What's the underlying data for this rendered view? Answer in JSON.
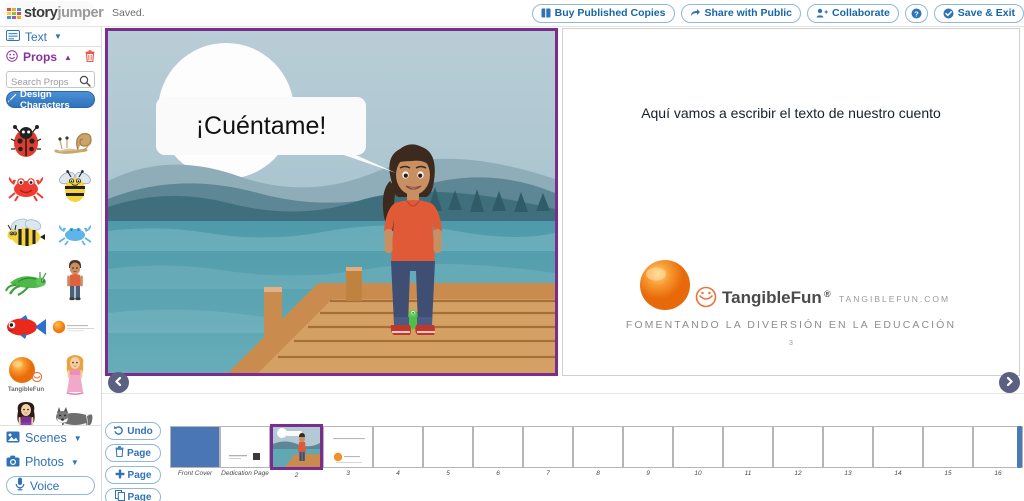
{
  "app": {
    "brand_story": "story",
    "brand_jumper": "jumper",
    "save_status": "Saved."
  },
  "header": {
    "buttons": [
      {
        "label": "Buy Published Copies",
        "icon": "book-icon"
      },
      {
        "label": "Share with Public",
        "icon": "share-arrow-icon"
      },
      {
        "label": "Collaborate",
        "icon": "add-user-icon"
      },
      {
        "label": "",
        "icon": "help-question-icon"
      },
      {
        "label": "Save & Exit",
        "icon": "check-circle-icon"
      }
    ]
  },
  "sidebar": {
    "text_panel": {
      "label": "Text",
      "icon": "text-box-icon",
      "caret": "▼"
    },
    "props_panel": {
      "label": "Props",
      "icon": "smiley-icon",
      "caret": "▲",
      "trash_icon": "trash-icon"
    },
    "search": {
      "placeholder": "Search Props",
      "value": "",
      "icon": "search-icon"
    },
    "design_button": {
      "label": "Design Characters",
      "icon": "brush-icon"
    },
    "props": [
      {
        "name": "ladybug"
      },
      {
        "name": "snail"
      },
      {
        "name": "red-crab"
      },
      {
        "name": "yellow-bee-character"
      },
      {
        "name": "bumblebee"
      },
      {
        "name": "blue-crab"
      },
      {
        "name": "grasshopper"
      },
      {
        "name": "boy-character"
      },
      {
        "name": "red-fish"
      },
      {
        "name": "tangiblefun-logo-wide"
      },
      {
        "name": "orange-ball-logo"
      },
      {
        "name": "princess-pink"
      },
      {
        "name": "princess-purple"
      },
      {
        "name": "husky-dog"
      }
    ],
    "scenes_panel": {
      "label": "Scenes",
      "icon": "image-icon",
      "caret": "▼"
    },
    "photos_panel": {
      "label": "Photos",
      "icon": "camera-icon",
      "caret": "▼"
    },
    "voice_button": {
      "label": "Voice",
      "icon": "microphone-icon"
    }
  },
  "canvas": {
    "left_page": {
      "speech_bubble_text": "¡Cuéntame!",
      "scene_name": "lake-dock-scene",
      "character_name": "girl-character",
      "prop_name": "frog-prop",
      "selected": true,
      "selection_color": "#7b2d8e"
    },
    "right_page": {
      "body_text": "Aquí vamos a escribir el texto de nuestro cuento",
      "brand_name": "TangibleFun",
      "brand_registered": "®",
      "brand_url": "TANGIBLEFUN.COM",
      "brand_tagline": "FOMENTANDO LA DIVERSIÓN EN LA EDUCACIÓN",
      "page_number": "3"
    },
    "nav_prev": {
      "icon": "chevron-left-icon"
    },
    "nav_next": {
      "icon": "chevron-right-icon"
    }
  },
  "filmstrip": {
    "tools": [
      {
        "label": "Undo",
        "icon": "undo-icon"
      },
      {
        "label": "Page",
        "icon": "trash-icon"
      },
      {
        "label": "Page",
        "icon": "plus-icon"
      },
      {
        "label": "Page",
        "icon": "copy-icon"
      }
    ],
    "thumbnails": [
      {
        "label": "Front Cover",
        "type": "cover",
        "selected": false
      },
      {
        "label": "Dedication Page",
        "type": "dedication",
        "selected": false
      },
      {
        "label": "2",
        "type": "scene",
        "selected": true
      },
      {
        "label": "3",
        "type": "brand",
        "selected": false
      },
      {
        "label": "4",
        "type": "blank",
        "selected": false
      },
      {
        "label": "5",
        "type": "blank",
        "selected": false
      },
      {
        "label": "6",
        "type": "blank",
        "selected": false
      },
      {
        "label": "7",
        "type": "blank",
        "selected": false
      },
      {
        "label": "8",
        "type": "blank",
        "selected": false
      },
      {
        "label": "9",
        "type": "blank",
        "selected": false
      },
      {
        "label": "10",
        "type": "blank",
        "selected": false
      },
      {
        "label": "11",
        "type": "blank",
        "selected": false
      },
      {
        "label": "12",
        "type": "blank",
        "selected": false
      },
      {
        "label": "13",
        "type": "blank",
        "selected": false
      },
      {
        "label": "14",
        "type": "blank",
        "selected": false
      },
      {
        "label": "15",
        "type": "blank",
        "selected": false
      },
      {
        "label": "16",
        "type": "blank",
        "selected": false
      }
    ]
  },
  "colors": {
    "accent_blue": "#2f72b8",
    "props_purple": "#8a2f9c",
    "selection_purple": "#7b2d8e",
    "brand_orange": "#f08020",
    "nav_slate": "#5c6080"
  }
}
